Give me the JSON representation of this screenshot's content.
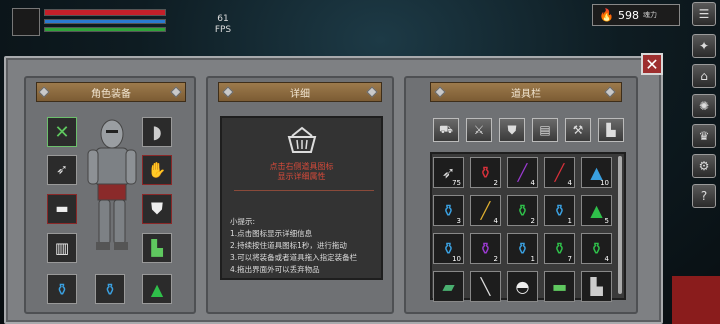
{
  "hud": {
    "fps_value": "61",
    "fps_label": "FPS",
    "soul_count": "598",
    "soul_label": "魂力",
    "health_fraction": 1.0,
    "mana_fraction": 1.0,
    "stamina_fraction": 1.0
  },
  "panels": {
    "equipment_title": "角色装备",
    "detail_title": "详细",
    "inventory_title": "道具栏"
  },
  "detail": {
    "hint_line1": "点击右侧道具图标",
    "hint_line2": "显示详细属性",
    "tips_title": "小提示:",
    "tip1": "1.点击图标显示详细信息",
    "tip2": "2.持续按住道具图标1秒，进行拖动",
    "tip3": "3.可以将装备或者道具拖入指定装备栏",
    "tip4": "4.拖出界面外可以丢弃物品"
  },
  "inventory": {
    "counts": [
      "75",
      "2",
      "4",
      "4",
      "10",
      "3",
      "4",
      "2",
      "1",
      "5",
      "10",
      "2",
      "1",
      "7",
      "4",
      "",
      "",
      "",
      "",
      ""
    ]
  },
  "colors": {
    "frame": "#7e8083",
    "title_bar": "#8c6a40",
    "hint_red": "#d44a3a",
    "close": "#9e2f2f"
  }
}
